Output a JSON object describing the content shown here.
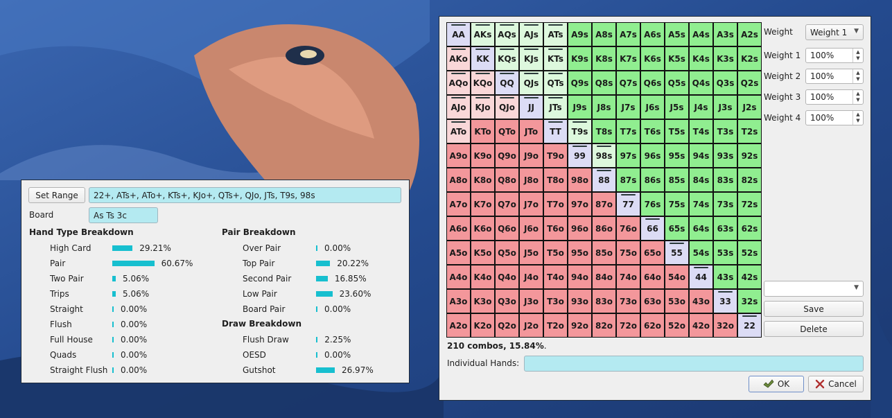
{
  "range_dialog": {
    "set_range_label": "Set Range",
    "range_value": "22+, ATs+, ATo+, KTs+, KJo+, QTs+, QJo, JTs, T9s, 98s",
    "board_label": "Board",
    "board_value": "As Ts 3c",
    "hand_type_header": "Hand Type Breakdown",
    "hand_types": [
      {
        "name": "High Card",
        "pct": "29.21%",
        "value": 29.21
      },
      {
        "name": "Pair",
        "pct": "60.67%",
        "value": 60.67
      },
      {
        "name": "Two Pair",
        "pct": "5.06%",
        "value": 5.06
      },
      {
        "name": "Trips",
        "pct": "5.06%",
        "value": 5.06
      },
      {
        "name": "Straight",
        "pct": "0.00%",
        "value": 0
      },
      {
        "name": "Flush",
        "pct": "0.00%",
        "value": 0
      },
      {
        "name": "Full House",
        "pct": "0.00%",
        "value": 0
      },
      {
        "name": "Quads",
        "pct": "0.00%",
        "value": 0
      },
      {
        "name": "Straight Flush",
        "pct": "0.00%",
        "value": 0
      }
    ],
    "pair_header": "Pair Breakdown",
    "pairs": [
      {
        "name": "Over Pair",
        "pct": "0.00%",
        "value": 0
      },
      {
        "name": "Top Pair",
        "pct": "20.22%",
        "value": 20.22
      },
      {
        "name": "Second Pair",
        "pct": "16.85%",
        "value": 16.85
      },
      {
        "name": "Low Pair",
        "pct": "23.60%",
        "value": 23.6
      },
      {
        "name": "Board Pair",
        "pct": "0.00%",
        "value": 0
      }
    ],
    "draw_header": "Draw Breakdown",
    "draws": [
      {
        "name": "Flush Draw",
        "pct": "2.25%",
        "value": 2.25
      },
      {
        "name": "OESD",
        "pct": "0.00%",
        "value": 0
      },
      {
        "name": "Gutshot",
        "pct": "26.97%",
        "value": 26.97
      }
    ]
  },
  "matrix_dialog": {
    "rows": [
      [
        "AA",
        "AKs",
        "AQs",
        "AJs",
        "ATs",
        "A9s",
        "A8s",
        "A7s",
        "A6s",
        "A5s",
        "A4s",
        "A3s",
        "A2s"
      ],
      [
        "AKo",
        "KK",
        "KQs",
        "KJs",
        "KTs",
        "K9s",
        "K8s",
        "K7s",
        "K6s",
        "K5s",
        "K4s",
        "K3s",
        "K2s"
      ],
      [
        "AQo",
        "KQo",
        "QQ",
        "QJs",
        "QTs",
        "Q9s",
        "Q8s",
        "Q7s",
        "Q6s",
        "Q5s",
        "Q4s",
        "Q3s",
        "Q2s"
      ],
      [
        "AJo",
        "KJo",
        "QJo",
        "JJ",
        "JTs",
        "J9s",
        "J8s",
        "J7s",
        "J6s",
        "J5s",
        "J4s",
        "J3s",
        "J2s"
      ],
      [
        "ATo",
        "KTo",
        "QTo",
        "JTo",
        "TT",
        "T9s",
        "T8s",
        "T7s",
        "T6s",
        "T5s",
        "T4s",
        "T3s",
        "T2s"
      ],
      [
        "A9o",
        "K9o",
        "Q9o",
        "J9o",
        "T9o",
        "99",
        "98s",
        "97s",
        "96s",
        "95s",
        "94s",
        "93s",
        "92s"
      ],
      [
        "A8o",
        "K8o",
        "Q8o",
        "J8o",
        "T8o",
        "98o",
        "88",
        "87s",
        "86s",
        "85s",
        "84s",
        "83s",
        "82s"
      ],
      [
        "A7o",
        "K7o",
        "Q7o",
        "J7o",
        "T7o",
        "97o",
        "87o",
        "77",
        "76s",
        "75s",
        "74s",
        "73s",
        "72s"
      ],
      [
        "A6o",
        "K6o",
        "Q6o",
        "J6o",
        "T6o",
        "96o",
        "86o",
        "76o",
        "66",
        "65s",
        "64s",
        "63s",
        "62s"
      ],
      [
        "A5o",
        "K5o",
        "Q5o",
        "J5o",
        "T5o",
        "95o",
        "85o",
        "75o",
        "65o",
        "55",
        "54s",
        "53s",
        "52s"
      ],
      [
        "A4o",
        "K4o",
        "Q4o",
        "J4o",
        "T4o",
        "94o",
        "84o",
        "74o",
        "64o",
        "54o",
        "44",
        "43s",
        "42s"
      ],
      [
        "A3o",
        "K3o",
        "Q3o",
        "J3o",
        "T3o",
        "93o",
        "83o",
        "73o",
        "63o",
        "53o",
        "43o",
        "33",
        "32s"
      ],
      [
        "A2o",
        "K2o",
        "Q2o",
        "J2o",
        "T2o",
        "92o",
        "82o",
        "72o",
        "62o",
        "52o",
        "42o",
        "32o",
        "22"
      ]
    ],
    "selected": [
      "AA",
      "AKs",
      "AQs",
      "AJs",
      "ATs",
      "AKo",
      "KK",
      "KQs",
      "KJs",
      "KTs",
      "AQo",
      "KQo",
      "QQ",
      "QJs",
      "QTs",
      "AJo",
      "KJo",
      "QJo",
      "JJ",
      "JTs",
      "ATo",
      "TT",
      "T9s",
      "99",
      "98s",
      "88",
      "77",
      "66",
      "55",
      "44",
      "33",
      "22"
    ],
    "colors": {
      "suited": "#90ee90",
      "suited_selected": "#ddf8dd",
      "offsuit": "#f3979b",
      "offsuit_selected": "#f9d7d8",
      "pair": "#dcdcf5"
    },
    "weight_label": "Weight",
    "weight_value": "Weight 1",
    "weights": [
      {
        "label": "Weight 1",
        "value": "100%"
      },
      {
        "label": "Weight 2",
        "value": "100%"
      },
      {
        "label": "Weight 3",
        "value": "100%"
      },
      {
        "label": "Weight 4",
        "value": "100%"
      }
    ],
    "preset_value": "",
    "save_label": "Save",
    "delete_label": "Delete",
    "combos_count": "210 combos, 15.84%",
    "combos_suffix": ".",
    "individual_hands_label": "Individual Hands:",
    "individual_hands_value": "",
    "ok_label": "OK",
    "cancel_label": "Cancel"
  }
}
